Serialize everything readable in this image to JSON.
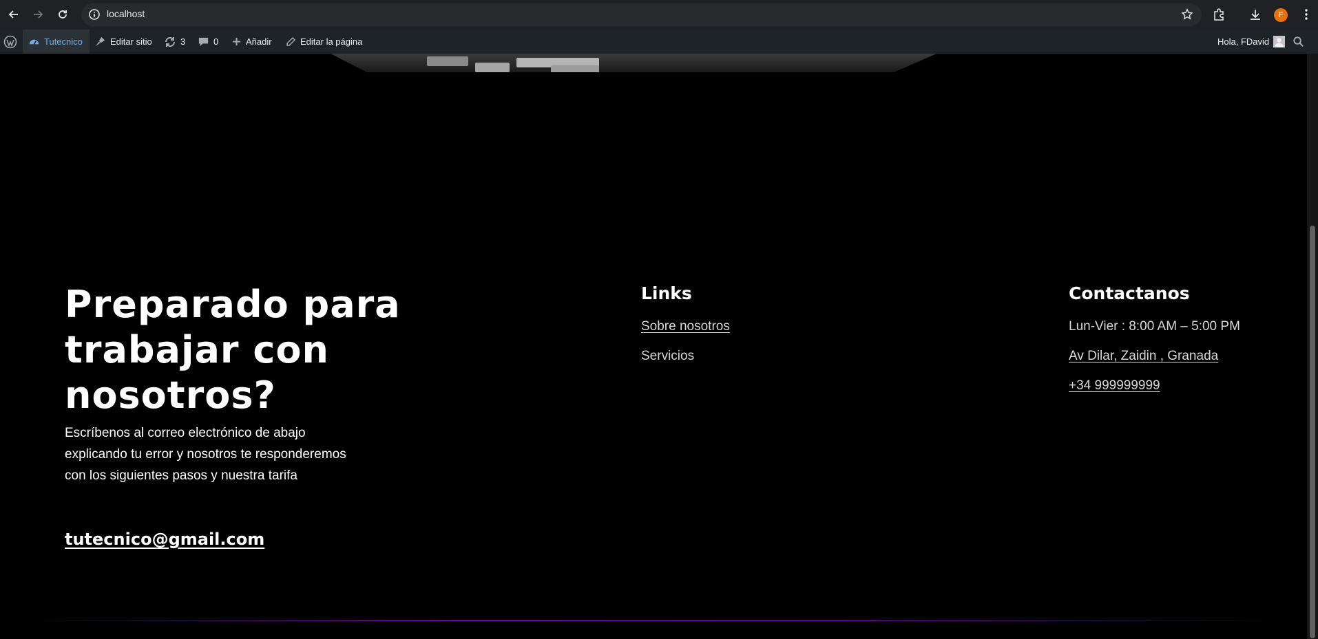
{
  "browser": {
    "url": "localhost",
    "profile_initial": "F"
  },
  "admin_bar": {
    "site_name": "Tutecnico",
    "edit_site": "Editar sitio",
    "updates_count": "3",
    "comments_count": "0",
    "add_new": "Añadir",
    "edit_page": "Editar la página",
    "greeting": "Hola, FDavid"
  },
  "cta": {
    "title": "Preparado para trabajar con nosotros?",
    "text": "Escríbenos al correo electrónico de abajo explicando tu error y nosotros te responderemos con los siguientes pasos y nuestra tarifa",
    "email": "tutecnico@gmail.com"
  },
  "links": {
    "heading": "Links",
    "items": [
      "Sobre nosotros",
      "Servicios"
    ]
  },
  "contact": {
    "heading": "Contactanos",
    "hours": "Lun-Vier : 8:00 AM – 5:00 PM",
    "address": "Av Dilar, Zaidin , Granada",
    "phone": "+34 999999999"
  },
  "colors": {
    "page_background": "#000000",
    "admin_bar": "#1d2327",
    "admin_active": "#72aee6",
    "divider_accent": "#8a1fc2"
  }
}
